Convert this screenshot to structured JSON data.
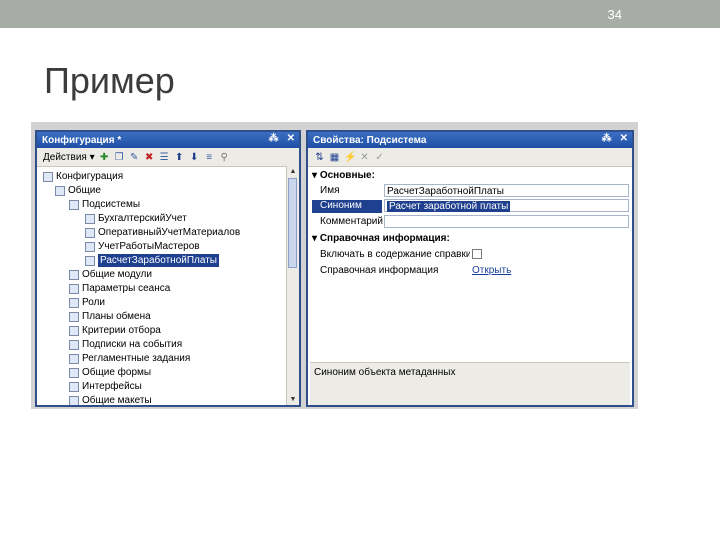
{
  "slide": {
    "page_number": "34",
    "title": "Пример"
  },
  "config_panel": {
    "title": "Конфигурация *",
    "pin": "⁂",
    "close": "✕",
    "actions_label": "Действия",
    "tree": [
      {
        "label": "Конфигурация",
        "level": 0
      },
      {
        "label": "Общие",
        "level": 1
      },
      {
        "label": "Подсистемы",
        "level": 2
      },
      {
        "label": "БухгалтерскийУчет",
        "level": 3
      },
      {
        "label": "ОперативныйУчетМатериалов",
        "level": 3
      },
      {
        "label": "УчетРаботыМастеров",
        "level": 3
      },
      {
        "label": "РасчетЗаработнойПлаты",
        "level": 3,
        "selected": true
      },
      {
        "label": "Общие модули",
        "level": 2
      },
      {
        "label": "Параметры сеанса",
        "level": 2
      },
      {
        "label": "Роли",
        "level": 2
      },
      {
        "label": "Планы обмена",
        "level": 2
      },
      {
        "label": "Критерии отбора",
        "level": 2
      },
      {
        "label": "Подписки на события",
        "level": 2
      },
      {
        "label": "Регламентные задания",
        "level": 2
      },
      {
        "label": "Общие формы",
        "level": 2
      },
      {
        "label": "Интерфейсы",
        "level": 2
      },
      {
        "label": "Общие макеты",
        "level": 2
      }
    ]
  },
  "props_panel": {
    "title": "Свойства: Подсистема",
    "pin": "⁂",
    "close": "✕",
    "section_main": "Основные:",
    "name_label": "Имя",
    "name_value": "РасчетЗаработнойПлаты",
    "synonym_label": "Синоним",
    "synonym_value": "Расчет заработной платы",
    "comment_label": "Комментарий",
    "comment_value": "",
    "section_help": "Справочная информация:",
    "include_label": "Включать в содержание справки",
    "help_label": "Справочная информация",
    "help_link": "Открыть",
    "description": "Синоним объекта метаданных"
  }
}
